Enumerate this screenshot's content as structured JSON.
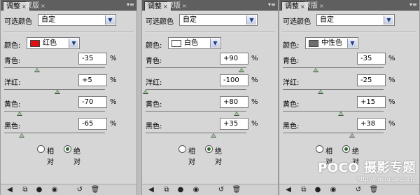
{
  "tabs": {
    "active": "调整",
    "inactive": "蒙版",
    "close_glyph": "×",
    "menu_glyph": "▾≡"
  },
  "preset": {
    "label": "可选颜色",
    "value": "自定"
  },
  "color_label": "颜色:",
  "mode": {
    "relative": "相对",
    "absolute": "绝对"
  },
  "percent": "%",
  "slider_labels": {
    "cyan": "青色:",
    "magenta": "洋红:",
    "yellow": "黄色:",
    "black": "黑色:"
  },
  "slider_range": [
    -100,
    100
  ],
  "panels": [
    {
      "color_name": "红色",
      "swatch": "#e01010",
      "cyan": "-35",
      "magenta": "+5",
      "yellow": "-70",
      "black": "-65",
      "absolute_selected": true
    },
    {
      "color_name": "白色",
      "swatch": "#ffffff",
      "cyan": "+90",
      "magenta": "-100",
      "yellow": "+80",
      "black": "+35",
      "absolute_selected": true
    },
    {
      "color_name": "中性色",
      "swatch": "#6e6e6e",
      "cyan": "-35",
      "magenta": "-25",
      "yellow": "+15",
      "black": "+38",
      "absolute_selected": true
    }
  ],
  "footer_icons": [
    "back-arrow-icon",
    "clip-layer-icon",
    "visibility-icon",
    "view-previous-icon",
    "reset-icon",
    "delete-icon"
  ],
  "watermark": {
    "main": "POCO 摄影专题",
    "sub": "http://photo.poco.cn/"
  }
}
